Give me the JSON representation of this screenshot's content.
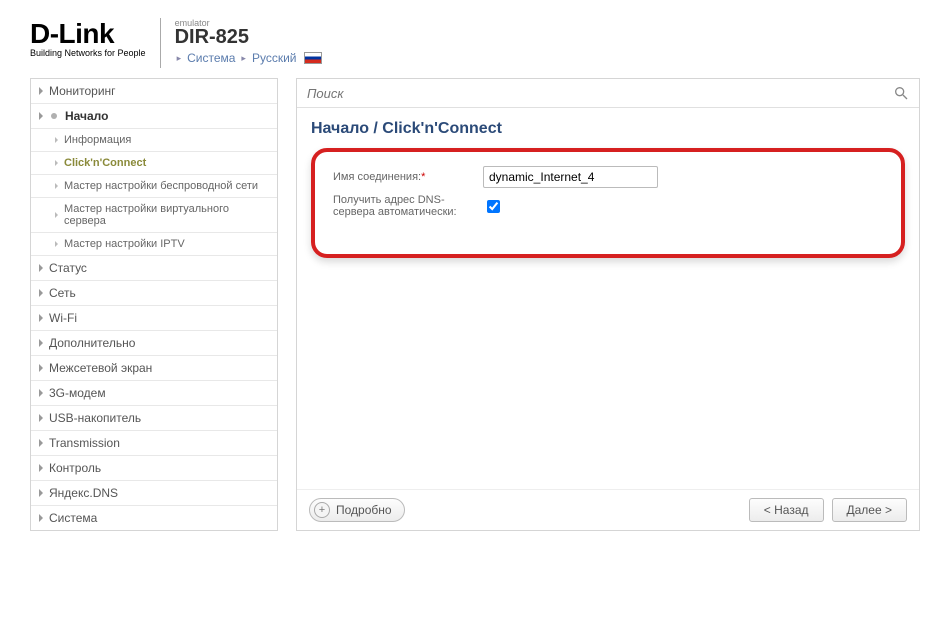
{
  "header": {
    "logo_main": "D-Link",
    "logo_sub": "Building Networks for People",
    "emulator": "emulator",
    "model": "DIR-825",
    "link_system": "Система",
    "link_lang": "Русский"
  },
  "sidebar": {
    "items": [
      {
        "label": "Мониторинг",
        "type": "top"
      },
      {
        "label": "Начало",
        "type": "top-active"
      },
      {
        "label": "Информация",
        "type": "sub"
      },
      {
        "label": "Click'n'Connect",
        "type": "sub-current"
      },
      {
        "label": "Мастер настройки беспроводной сети",
        "type": "sub"
      },
      {
        "label": "Мастер настройки виртуального сервера",
        "type": "sub"
      },
      {
        "label": "Мастер настройки IPTV",
        "type": "sub"
      },
      {
        "label": "Статус",
        "type": "top"
      },
      {
        "label": "Сеть",
        "type": "top"
      },
      {
        "label": "Wi-Fi",
        "type": "top"
      },
      {
        "label": "Дополнительно",
        "type": "top"
      },
      {
        "label": "Межсетевой экран",
        "type": "top"
      },
      {
        "label": "3G-модем",
        "type": "top"
      },
      {
        "label": "USB-накопитель",
        "type": "top"
      },
      {
        "label": "Transmission",
        "type": "top"
      },
      {
        "label": "Контроль",
        "type": "top"
      },
      {
        "label": "Яндекс.DNS",
        "type": "top"
      },
      {
        "label": "Система",
        "type": "top"
      }
    ]
  },
  "search": {
    "placeholder": "Поиск"
  },
  "breadcrumb": "Начало  /  Click'n'Connect",
  "form": {
    "name_label": "Имя соединения:",
    "name_value": "dynamic_Internet_4",
    "dns_label": "Получить адрес DNS-сервера автоматически:",
    "dns_checked": true
  },
  "buttons": {
    "detail": "Подробно",
    "back": "< Назад",
    "next": "Далее >"
  }
}
